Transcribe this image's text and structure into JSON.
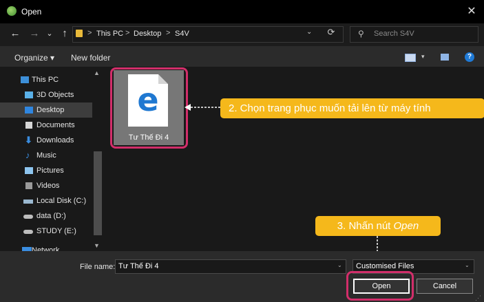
{
  "window": {
    "title": "Open",
    "close": "✕"
  },
  "nav": {
    "back": "←",
    "forward": "→",
    "recent": "⌄",
    "up": "↑",
    "breadcrumb": [
      "This PC",
      "Desktop",
      "S4V"
    ],
    "separator": ">",
    "refresh": "⟳",
    "search_placeholder": "Search S4V"
  },
  "toolbar": {
    "organize": "Organize ▾",
    "new_folder": "New folder",
    "help": "?"
  },
  "sidebar": {
    "items": [
      {
        "label": "This PC",
        "icon": "pc-icon"
      },
      {
        "label": "3D Objects",
        "icon": "cube-icon"
      },
      {
        "label": "Desktop",
        "icon": "desktop-icon",
        "selected": true
      },
      {
        "label": "Documents",
        "icon": "documents-icon"
      },
      {
        "label": "Downloads",
        "icon": "download-icon"
      },
      {
        "label": "Music",
        "icon": "music-icon"
      },
      {
        "label": "Pictures",
        "icon": "pictures-icon"
      },
      {
        "label": "Videos",
        "icon": "videos-icon"
      },
      {
        "label": "Local Disk (C:)",
        "icon": "drive-icon"
      },
      {
        "label": "data (D:)",
        "icon": "drive-icon"
      },
      {
        "label": "STUDY (E:)",
        "icon": "drive-icon"
      },
      {
        "label": "Network",
        "icon": "network-icon"
      }
    ]
  },
  "files": [
    {
      "name": "Tư Thế Đi 4",
      "icon": "edge-icon",
      "glyph": "e"
    }
  ],
  "callouts": {
    "step2": "2. Chọn trang phục muốn tải lên từ máy tính",
    "step3_prefix": "3. Nhấn nút ",
    "step3_em": "Open"
  },
  "bottom": {
    "file_name_label": "File name:",
    "file_name_value": "Tư Thế Đi 4",
    "filter_value": "Customised Files",
    "open": "Open",
    "cancel": "Cancel"
  },
  "colors": {
    "highlight": "#d22e6a",
    "callout": "#f5b81b",
    "accent": "#1f78d1"
  }
}
